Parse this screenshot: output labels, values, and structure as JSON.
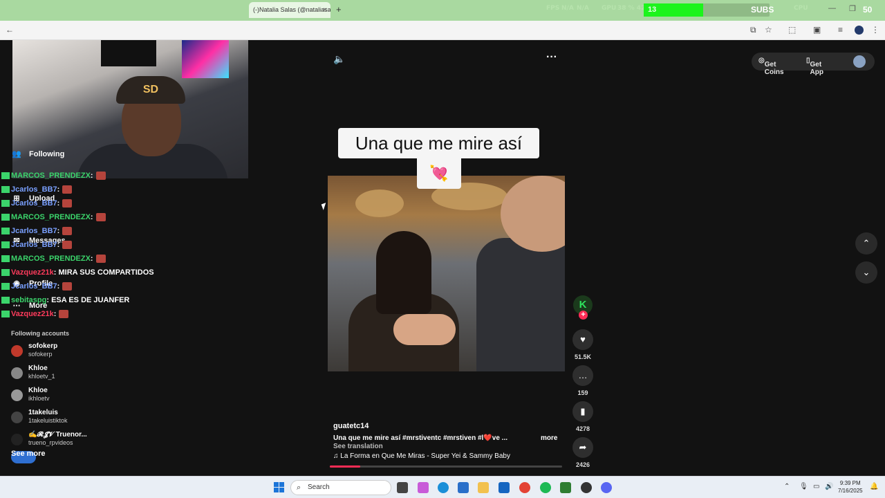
{
  "browser": {
    "tab_title": "(-)Natalia Salas (@nataliasal",
    "tab_close": "×",
    "new_tab": "+",
    "window_controls": [
      "—",
      "❐",
      "✕"
    ]
  },
  "overlay": {
    "fps_label": "FPS",
    "fps_value": "N/A",
    "fps_value2": "N/A",
    "gpu_label": "GPU",
    "gpu_value": "38 % 42",
    "cpu_label": "CPU",
    "gauge_number": "13",
    "gauge_fill_fraction": 0.47,
    "subs_label": "SUBS",
    "subs_count": "50"
  },
  "webcam": {
    "cap_logo": "SD"
  },
  "chat": [
    {
      "user": "MARCOS_PRENDEZX",
      "color": "#3bd46b",
      "text": ":",
      "emote": true
    },
    {
      "user": "Jcarlos_BB7",
      "color": "#7aa0ff",
      "text": ":",
      "emote": true
    },
    {
      "user": "Jcarlos_BB7",
      "color": "#7aa0ff",
      "text": ":",
      "emote": true
    },
    {
      "user": "MARCOS_PRENDEZX",
      "color": "#3bd46b",
      "text": ":",
      "emote": true
    },
    {
      "user": "Jcarlos_BB7",
      "color": "#7aa0ff",
      "text": ":",
      "emote": true
    },
    {
      "user": "Jcarlos_BB7",
      "color": "#7aa0ff",
      "text": ":",
      "emote": true
    },
    {
      "user": "MARCOS_PRENDEZX",
      "color": "#3bd46b",
      "text": ":",
      "emote": true
    },
    {
      "user": "Vazquez21k",
      "color": "#ff3b5c",
      "text": ": MIRA SUS COMPARTIDOS",
      "emote": false
    },
    {
      "user": "Jcarlos_BB7",
      "color": "#7aa0ff",
      "text": ":",
      "emote": true
    },
    {
      "user": "sebitaspg",
      "color": "#3bd46b",
      "text": ": ESA ES DE JUANFER",
      "emote": false
    },
    {
      "user": "Vazquez21k",
      "color": "#ff3b5c",
      "text": ":",
      "emote": true
    }
  ],
  "nav": {
    "following": "Following",
    "upload": "Upload",
    "messages": "Messages",
    "profile": "Profile",
    "more": "More"
  },
  "following_accounts": {
    "heading": "Following accounts",
    "items": [
      {
        "name": "sofokerp",
        "handle": "sofokerp"
      },
      {
        "name": "Khloe",
        "handle": "khloetv_1"
      },
      {
        "name": "Khloe",
        "handle": "ikhloetv"
      },
      {
        "name": "1takeluis",
        "handle": "1takeluistiktok"
      },
      {
        "name": "✍️𝓡𝓙𝓥 Truenor...",
        "handle": "trueno_rpvideos"
      }
    ],
    "see_more": "See more"
  },
  "top_actions": {
    "get_coins": "Get Coins",
    "get_app": "Get App"
  },
  "video": {
    "caption_line1": "Una que me mire así",
    "caption_emoji": "💘",
    "author": "guatetc14",
    "description": "Una que me mire así #mrstiventc  #mrstiven  #l❤️ve  ...",
    "more": "more",
    "see_translation": "See translation",
    "music": "♫ La Forma en Que Me Miras - Super Yei & Sammy Baby",
    "progress_fraction": 0.13
  },
  "actions": {
    "likes": "51.5K",
    "comments": "159",
    "saves": "4278",
    "shares": "2426"
  },
  "taskbar": {
    "search_placeholder": "Search",
    "time": "9:39 PM",
    "date": "7/16/2025"
  },
  "colors": {
    "accent": "#fe2c55",
    "browser_tab_bar": "#a9d9a0",
    "gauge_fill": "#1cf41c"
  }
}
